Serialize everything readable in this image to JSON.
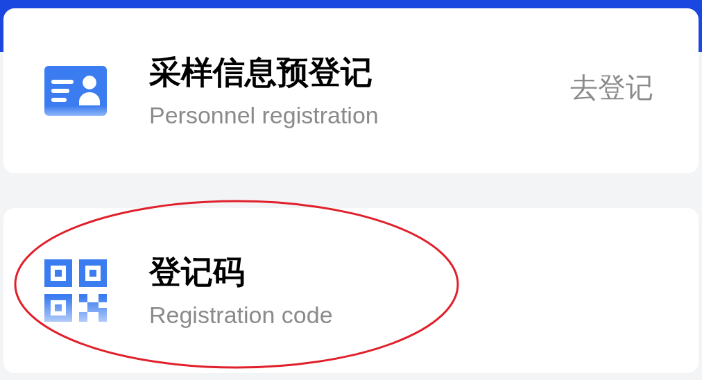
{
  "items": [
    {
      "kind": "card",
      "title": "采样信息预登记",
      "subtitle": "Personnel registration",
      "action": "去登记",
      "highlighted": false
    },
    {
      "kind": "qr",
      "title": "登记码",
      "subtitle": "Registration code",
      "highlighted": true
    }
  ]
}
